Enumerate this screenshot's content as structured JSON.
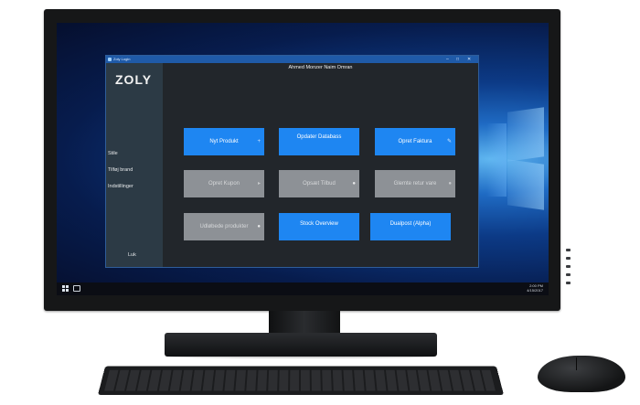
{
  "app": {
    "title": "Zoly Login",
    "logo": "ZOLY",
    "user": "Ahmed Monzer Naim Omran"
  },
  "sidebar": {
    "items": [
      {
        "label": "Stile"
      },
      {
        "label": "Tilføj brand"
      },
      {
        "label": "Indstillinger"
      }
    ],
    "close_label": "Luk"
  },
  "buttons": [
    {
      "label": "Nyt Produkt",
      "state": "active"
    },
    {
      "label": "Opdater Databass",
      "state": "active"
    },
    {
      "label": "Opret Faktura",
      "state": "active"
    },
    {
      "label": "Opret Kupon",
      "state": "disabled"
    },
    {
      "label": "Opsæt Tilbud",
      "state": "disabled"
    },
    {
      "label": "Glemte retur vare",
      "state": "disabled"
    },
    {
      "label": "Udløbede produkter",
      "state": "disabled"
    },
    {
      "label": "Stock Overview",
      "state": "active"
    },
    {
      "label": "Dualpost (Alpha)",
      "state": "active"
    }
  ],
  "window_controls": {
    "minimize": "–",
    "maximize": "□",
    "close": "✕"
  },
  "taskbar": {
    "time": "2:00 PM",
    "date": "4/15/2017"
  },
  "colors": {
    "accent": "#1e86f2",
    "disabled": "#8d9196",
    "sidebar": "#2c3a45",
    "content": "#22262b",
    "titlebar": "#1f5aa8"
  }
}
